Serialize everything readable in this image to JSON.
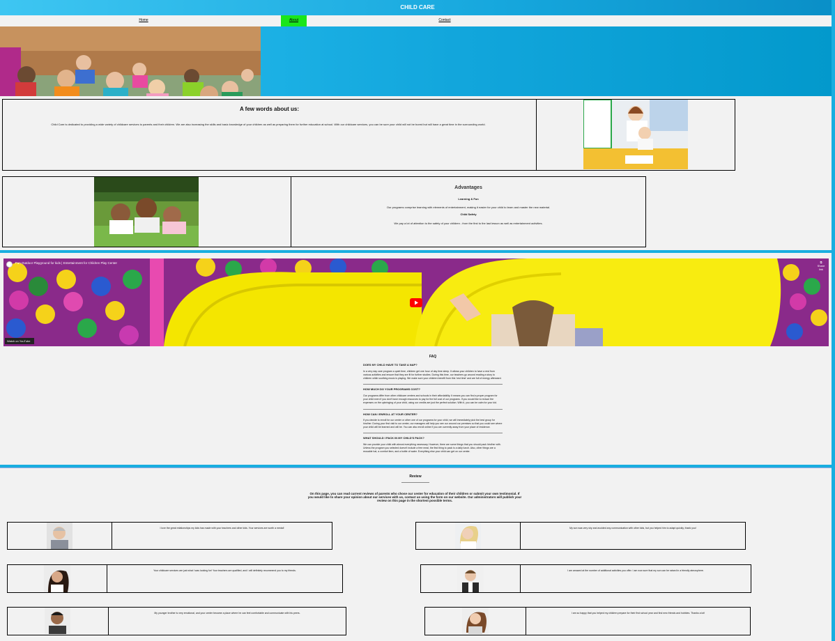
{
  "header": {
    "title": "CHILD CARE"
  },
  "nav": {
    "home": "Home",
    "about": "About",
    "contact": "Contact"
  },
  "about": {
    "title": "A few words about us:",
    "text": "Child Care is dedicated to providing a wide variety of childcare services to parents and their children. We are also increasing the skills and basic knowledge of your children as well as preparing them for further education at school. With our childcare services, you can be sure your child will not be bored but will have a great time in the surrounding world."
  },
  "advantages": {
    "title": "Advantages",
    "items": [
      {
        "heading": "Learning & Fun",
        "text": "Our programs comprise learning with elements of entertainment, making it easier for your child to learn and master the new material."
      },
      {
        "heading": "Child Safety",
        "text": "We pay a lot of attention to the safety of your children - from the first to the last lesson as well as entertainment activities."
      }
    ]
  },
  "video": {
    "title": "Fun Outdoor Playground for kids | Entertainment for Children Play Center",
    "share": "Share link",
    "watch": "Watch on  YouTube"
  },
  "faq": {
    "title": "FAQ",
    "items": [
      {
        "q": "DOES MY CHILD HAVE TO TAKE A NAP?",
        "a": "In a very day care program a quiet time, children get one hour of day time sleep. It allows your children to have a rest from various activities and ensure that they are fit for further studies. During this time, our teachers go around reading a story to children while soothing music is playing. We make sure your children benefit from this 'rest time' and are full of energy afterward."
      },
      {
        "q": "HOW MUCH DO YOUR PROGRAMS COST?",
        "a": "Our programs differ from other childcare centers and schools in their affordability. It means you can find a proper program for your child even if you don't have enough resources to pay for the full cost of our programs. If you would like to reduce the expenses on the upbringing of your child, using our credits are just the perfect solution. With it, you can be calm for your kid."
      },
      {
        "q": "HOW CAN I ENROLL AT YOUR CENTER?",
        "a": "If you decide to enroll for our center or other one of our programs for your child, we will immediately pick the best group for him/her. During your first visit to our center, our managers will help you see our around our premises so that you could see where your child will be learned and will be. You can also enroll online if you are currently away from your place of residence."
      },
      {
        "q": "WHAT SHOULD I PACK IN MY CHILD'S PACK?",
        "a": "We can provide your child with almost everything necessary. However, there are some things that you should pack him/her with. Unless the program you selected doesn't include a free meal, the first thing to pack is a daily lunch. Also, other things are a reusable hat, a comfort item, and a bottle of water. Everything else your child can get on our center."
      }
    ]
  },
  "reviews": {
    "title": "Review",
    "intro": "On this page, you can read current reviews of parents who chose our center for education of their children or submit your own testimonial. If you would like to share your opinion about our services with us, contact us using the form on our website. Our administrators will publish your review on this page in the shortest possible terms.",
    "items": [
      {
        "text": "I love the great relationships my kids has made with your teachers and other kids. Your services are worth a medal!"
      },
      {
        "text": "My son was very shy and avoided any communication with other kids, but you helped him to adapt quickly, thank you!"
      },
      {
        "text": "Your childcare services are just what I was looking for! Your teachers are qualified, and I will definitely recommend you to my friends."
      },
      {
        "text": "I am amazed at the number of additional activities you offer. I am now sure that my son can be raised in a friendly atmosphere."
      },
      {
        "text": "My younger brother is very emotional, and your center became a place where he can feel comfortable and communicate with his peers."
      },
      {
        "text": "I am so happy that you helped my children prepare for their first school year and find new friends and hobbies. Thanks a lot!"
      }
    ]
  },
  "colors": {
    "accent": "#19aee0",
    "nav_active": "#1ae61a",
    "youtube": "#ff0000"
  }
}
